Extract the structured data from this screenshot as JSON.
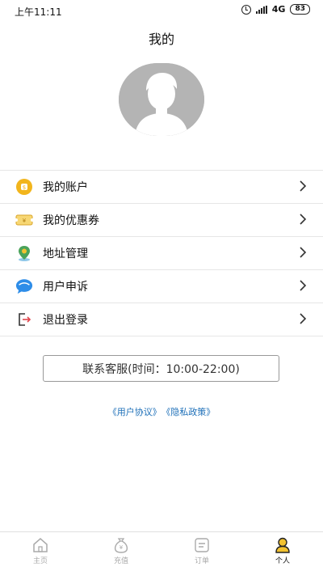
{
  "status_bar": {
    "time": "上午11:11",
    "network": "4G",
    "battery": "83"
  },
  "header": {
    "title": "我的"
  },
  "menu": {
    "items": [
      {
        "label": "我的账户",
        "icon": "wallet-icon"
      },
      {
        "label": "我的优惠券",
        "icon": "coupon-icon"
      },
      {
        "label": "地址管理",
        "icon": "location-pin-icon"
      },
      {
        "label": "用户申诉",
        "icon": "chat-bubble-icon"
      },
      {
        "label": "退出登录",
        "icon": "logout-icon"
      }
    ]
  },
  "service": {
    "label": "联系客服(时间：10:00-22:00)"
  },
  "legal": {
    "user_agreement": "《用户协议》",
    "privacy_policy": "《隐私政策》"
  },
  "tabbar": {
    "items": [
      {
        "label": "主页",
        "icon": "home-icon",
        "active": false
      },
      {
        "label": "充值",
        "icon": "recharge-icon",
        "active": false
      },
      {
        "label": "订单",
        "icon": "order-icon",
        "active": false
      },
      {
        "label": "个人",
        "icon": "person-icon",
        "active": true
      }
    ]
  },
  "colors": {
    "link": "#1d6fb8",
    "divider": "#e6e6e6",
    "avatar_bg": "#b4b4b4",
    "coin": "#f2b51c",
    "chat": "#2e8de8"
  }
}
